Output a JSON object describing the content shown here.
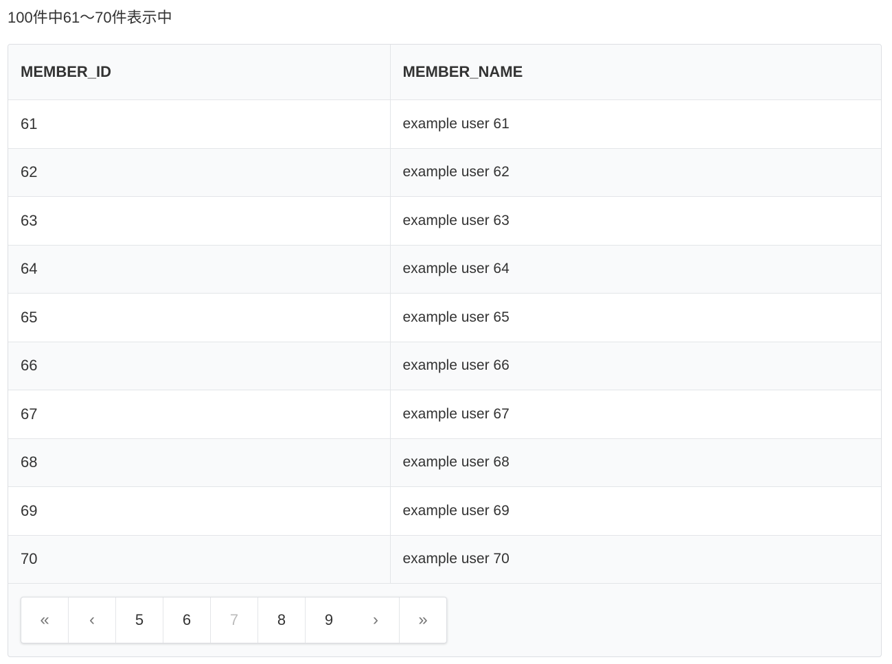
{
  "summary": "100件中61〜70件表示中",
  "table": {
    "headers": [
      "MEMBER_ID",
      "MEMBER_NAME"
    ],
    "rows": [
      {
        "id": "61",
        "name": "example user 61"
      },
      {
        "id": "62",
        "name": "example user 62"
      },
      {
        "id": "63",
        "name": "example user 63"
      },
      {
        "id": "64",
        "name": "example user 64"
      },
      {
        "id": "65",
        "name": "example user 65"
      },
      {
        "id": "66",
        "name": "example user 66"
      },
      {
        "id": "67",
        "name": "example user 67"
      },
      {
        "id": "68",
        "name": "example user 68"
      },
      {
        "id": "69",
        "name": "example user 69"
      },
      {
        "id": "70",
        "name": "example user 70"
      }
    ]
  },
  "pagination": {
    "first": "«",
    "prev": "‹",
    "pages": [
      "5",
      "6",
      "7",
      "8",
      "9"
    ],
    "current": "7",
    "next": "›",
    "last": "»"
  }
}
